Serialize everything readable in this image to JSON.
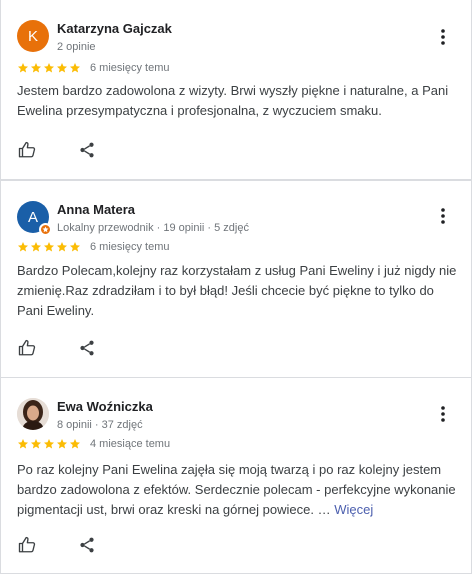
{
  "reviews": [
    {
      "name": "Katarzyna Gajczak",
      "meta": "2 opinie",
      "avatar_letter": "K",
      "avatar_color": "#e8710a",
      "rating": 5,
      "when": "6 miesięcy temu",
      "text": "Jestem bardzo zadowolona z wizyty. Brwi wyszły piękne i naturalne, a Pani Ewelina przesympatyczna i profesjonalna, z wyczuciem smaku.",
      "more": ""
    },
    {
      "name": "Anna Matera",
      "meta": "Lokalny przewodnik · 19 opinii · 5 zdjęć",
      "avatar_letter": "A",
      "avatar_color": "#1a5fa8",
      "local_guide_badge": true,
      "rating": 5,
      "when": "6 miesięcy temu",
      "text": "Bardzo Polecam,kolejny raz korzystałam z usług Pani Eweliny i już nigdy nie zmienię.Raz zdradziłam i to był błąd! Jeśli chcecie być piękne to tylko do Pani Eweliny.",
      "more": ""
    },
    {
      "name": "Ewa Woźniczka",
      "meta": "8 opinii · 37 zdjęć",
      "avatar_photo": true,
      "rating": 5,
      "when": "4 miesiące temu",
      "text": "Po raz kolejny Pani Ewelina zajęła się moją twarzą i po raz kolejny jestem bardzo zadowolona z efektów. Serdecznie polecam - perfekcyjne wykonanie pigmentacji ust, brwi oraz kreski na górnej powiece. …",
      "more": "Więcej"
    }
  ],
  "colors": {
    "star": "#fbbc04",
    "link": "#4c5fae",
    "text": "#3c4043",
    "secondary": "#70757a"
  },
  "icons": {
    "more": "more-vert-icon",
    "like": "thumb-up-icon",
    "share": "share-icon",
    "star": "star-icon",
    "local_guide": "local-guide-badge-icon"
  }
}
